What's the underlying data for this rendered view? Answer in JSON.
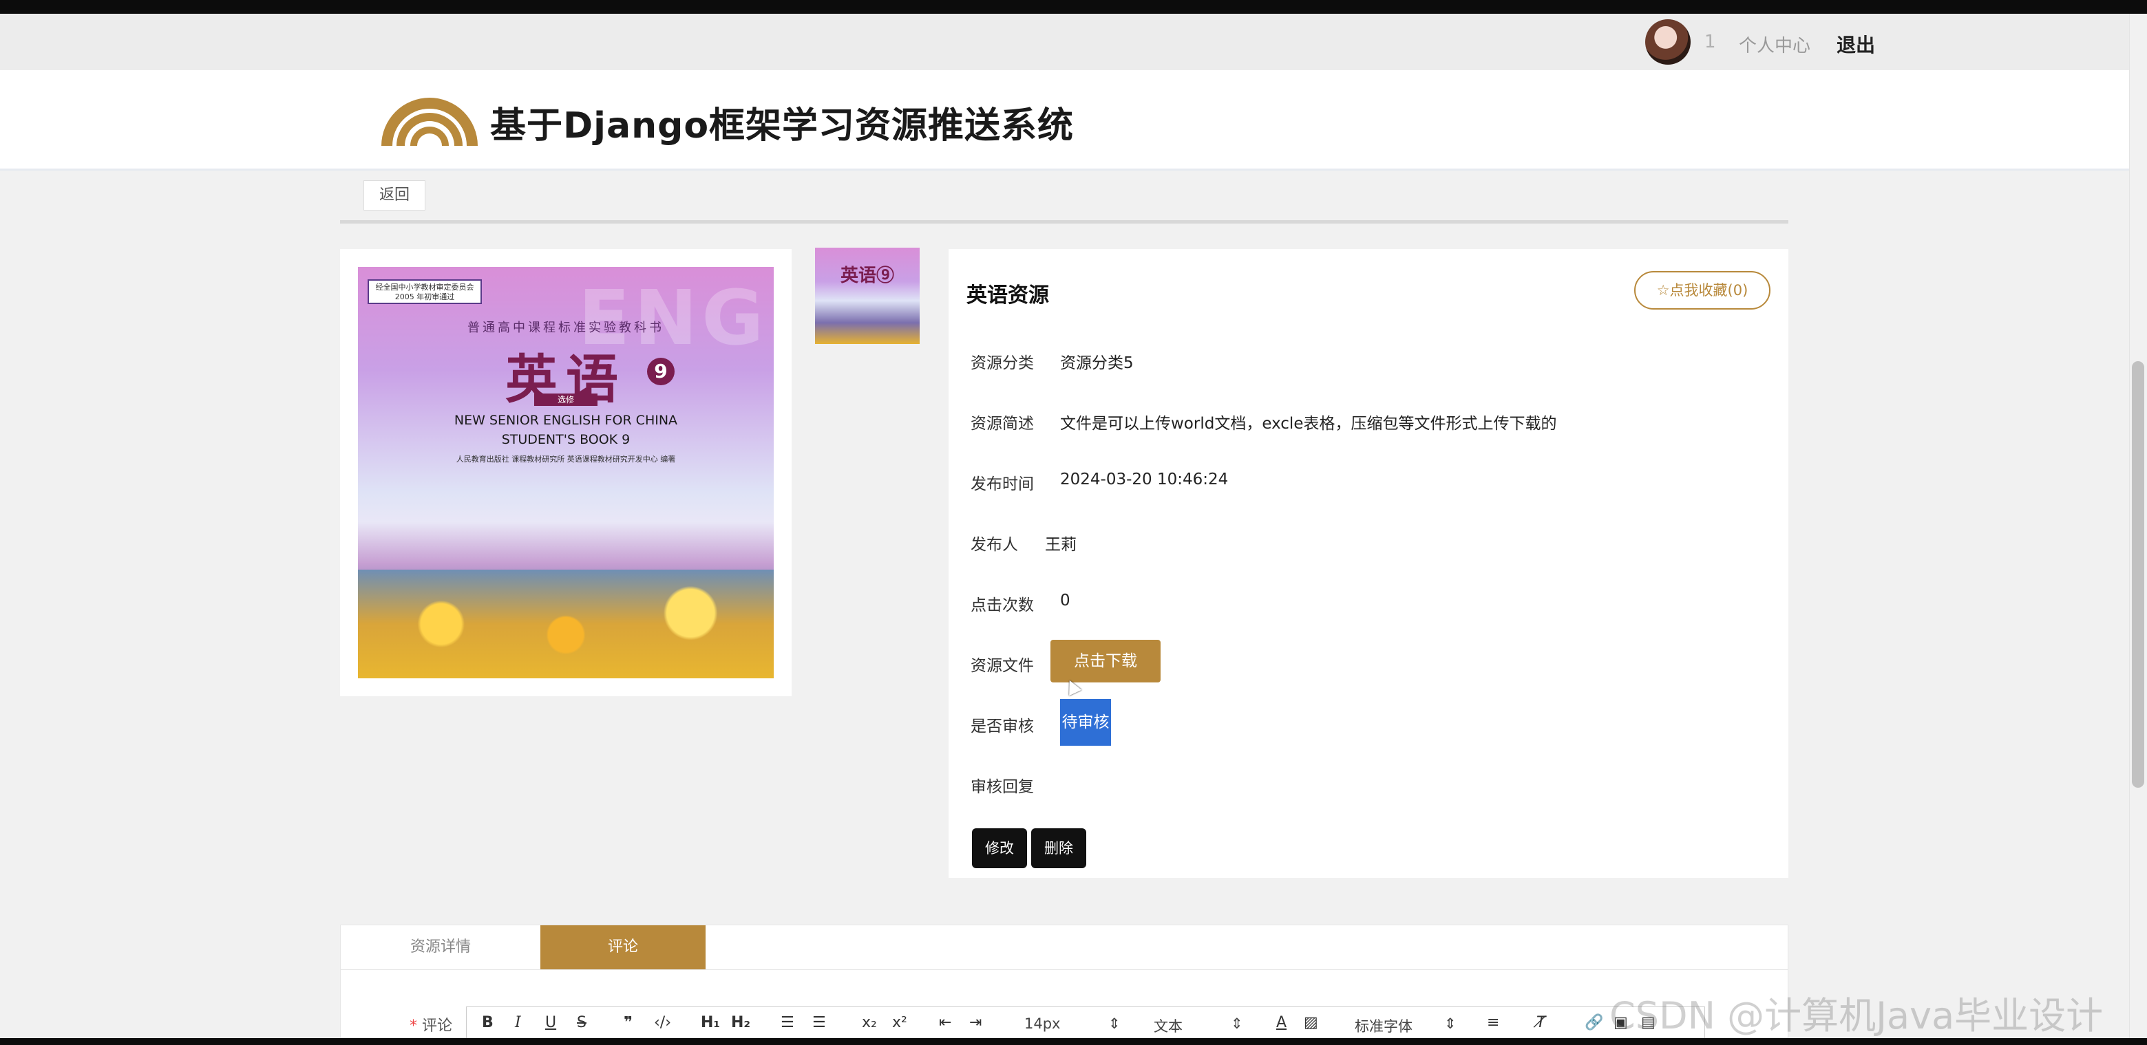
{
  "topbar": {
    "user_id": "1",
    "personal_center": "个人中心",
    "logout": "退出"
  },
  "header": {
    "site_title": "基于Django框架学习资源推送系统"
  },
  "nav": {
    "back_label": "返回"
  },
  "cover": {
    "badge": "经全国中小学教材审定委员会 2005 年初审通过",
    "series": "普通高中课程标准实验教科书",
    "title_cn": "英语",
    "book_number": "9",
    "volume_tag": "选修",
    "title_en_line1": "NEW SENIOR ENGLISH FOR CHINA",
    "title_en_line2": "STUDENT'S BOOK 9",
    "publisher": "人民教育出版社  课程教材研究所  英语课程教材研究开发中心  编著",
    "ghost_text": "ENGLISH"
  },
  "thumb": {
    "title_cn": "英语⑨"
  },
  "resource": {
    "name": "英语资源",
    "favorite_label": "☆点我收藏(0)",
    "fields": {
      "category_label": "资源分类",
      "category_value": "资源分类5",
      "summary_label": "资源简述",
      "summary_value": "文件是可以上传world文档，excle表格，压缩包等文件形式上传下载的",
      "publish_time_label": "发布时间",
      "publish_time_value": "2024-03-20 10:46:24",
      "publisher_label": "发布人",
      "publisher_value": "王莉",
      "clicks_label": "点击次数",
      "clicks_value": "0",
      "file_label": "资源文件",
      "download_label": "点击下载",
      "audit_label": "是否审核",
      "audit_value": "待审核",
      "reply_label": "审核回复"
    },
    "edit_label": "修改",
    "delete_label": "删除"
  },
  "tabs": {
    "detail_label": "资源详情",
    "comment_label": "评论"
  },
  "comment": {
    "required_mark": "*",
    "label": "评论",
    "toolbar": {
      "font_size": "14px",
      "block_format": "文本",
      "font_family": "标准字体"
    }
  },
  "watermark": "CSDN @计算机Java毕业设计"
}
